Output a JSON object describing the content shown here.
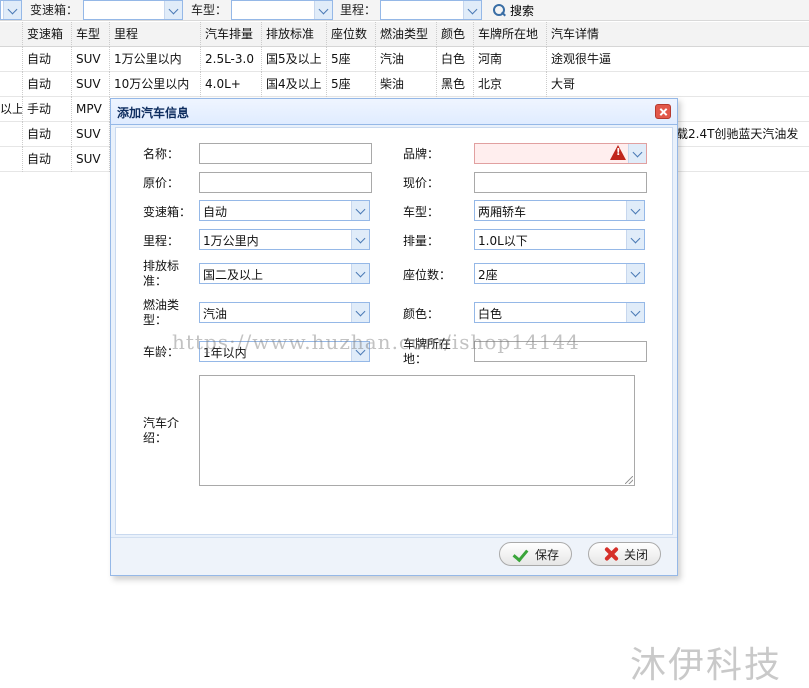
{
  "toolbar": {
    "gearbox_label": "变速箱：",
    "type_label": "车型：",
    "mileage_label": "里程：",
    "search_label": "搜索"
  },
  "grid": {
    "columns": [
      "变速箱",
      "车型",
      "里程",
      "汽车排量",
      "排放标准",
      "座位数",
      "燃油类型",
      "颜色",
      "车牌所在地",
      "汽车详情"
    ],
    "rows": [
      {
        "lead": "",
        "cells": [
          "自动",
          "SUV",
          "1万公里以内",
          "2.5L-3.0",
          "国5及以上",
          "5座",
          "汽油",
          "白色",
          "河南",
          "途观很牛逼"
        ]
      },
      {
        "lead": "",
        "cells": [
          "自动",
          "SUV",
          "10万公里以内",
          "4.0L+",
          "国4及以上",
          "5座",
          "柴油",
          "黑色",
          "北京",
          "大哥"
        ]
      },
      {
        "lead": "以上",
        "cells": [
          "手动",
          "MPV",
          "",
          "",
          "",
          "",
          "",
          "",
          "",
          ""
        ]
      },
      {
        "lead": "",
        "cells": [
          "自动",
          "SUV",
          "",
          "",
          "",
          "",
          "",
          "",
          "",
          "载2.4T创驰蓝天汽油发"
        ]
      },
      {
        "lead": "",
        "cells": [
          "自动",
          "SUV",
          "",
          "",
          "",
          "",
          "",
          "",
          "",
          ""
        ]
      }
    ]
  },
  "dialog": {
    "title": "添加汽车信息",
    "fields": {
      "name": {
        "label": "名称：",
        "value": ""
      },
      "brand": {
        "label": "品牌：",
        "value": ""
      },
      "original_price": {
        "label": "原价：",
        "value": ""
      },
      "current_price": {
        "label": "现价：",
        "value": ""
      },
      "gearbox": {
        "label": "变速箱：",
        "value": "自动"
      },
      "car_type": {
        "label": "车型：",
        "value": "两厢轿车"
      },
      "mileage": {
        "label": "里程：",
        "value": "1万公里内"
      },
      "displacement": {
        "label": "排量：",
        "value": "1.0L以下"
      },
      "emission_l1": "排放标",
      "emission_l2": "准：",
      "emission_value": "国二及以上",
      "seats": {
        "label": "座位数：",
        "value": "2座"
      },
      "fuel_l1": "燃油类",
      "fuel_l2": "型：",
      "fuel_value": "汽油",
      "color": {
        "label": "颜色：",
        "value": "白色"
      },
      "age": {
        "label": "车龄：",
        "value": "1年以内"
      },
      "plate_l1": "车牌所在",
      "plate_l2": "地：",
      "plate_value": "",
      "intro_l1": "汽车介",
      "intro_l2": "绍：",
      "intro_value": ""
    },
    "save_label": "保存",
    "close_label": "关闭"
  },
  "watermark": {
    "url": "https://www.huzhan.com/ishop14144",
    "brand": "沐伊科技"
  }
}
